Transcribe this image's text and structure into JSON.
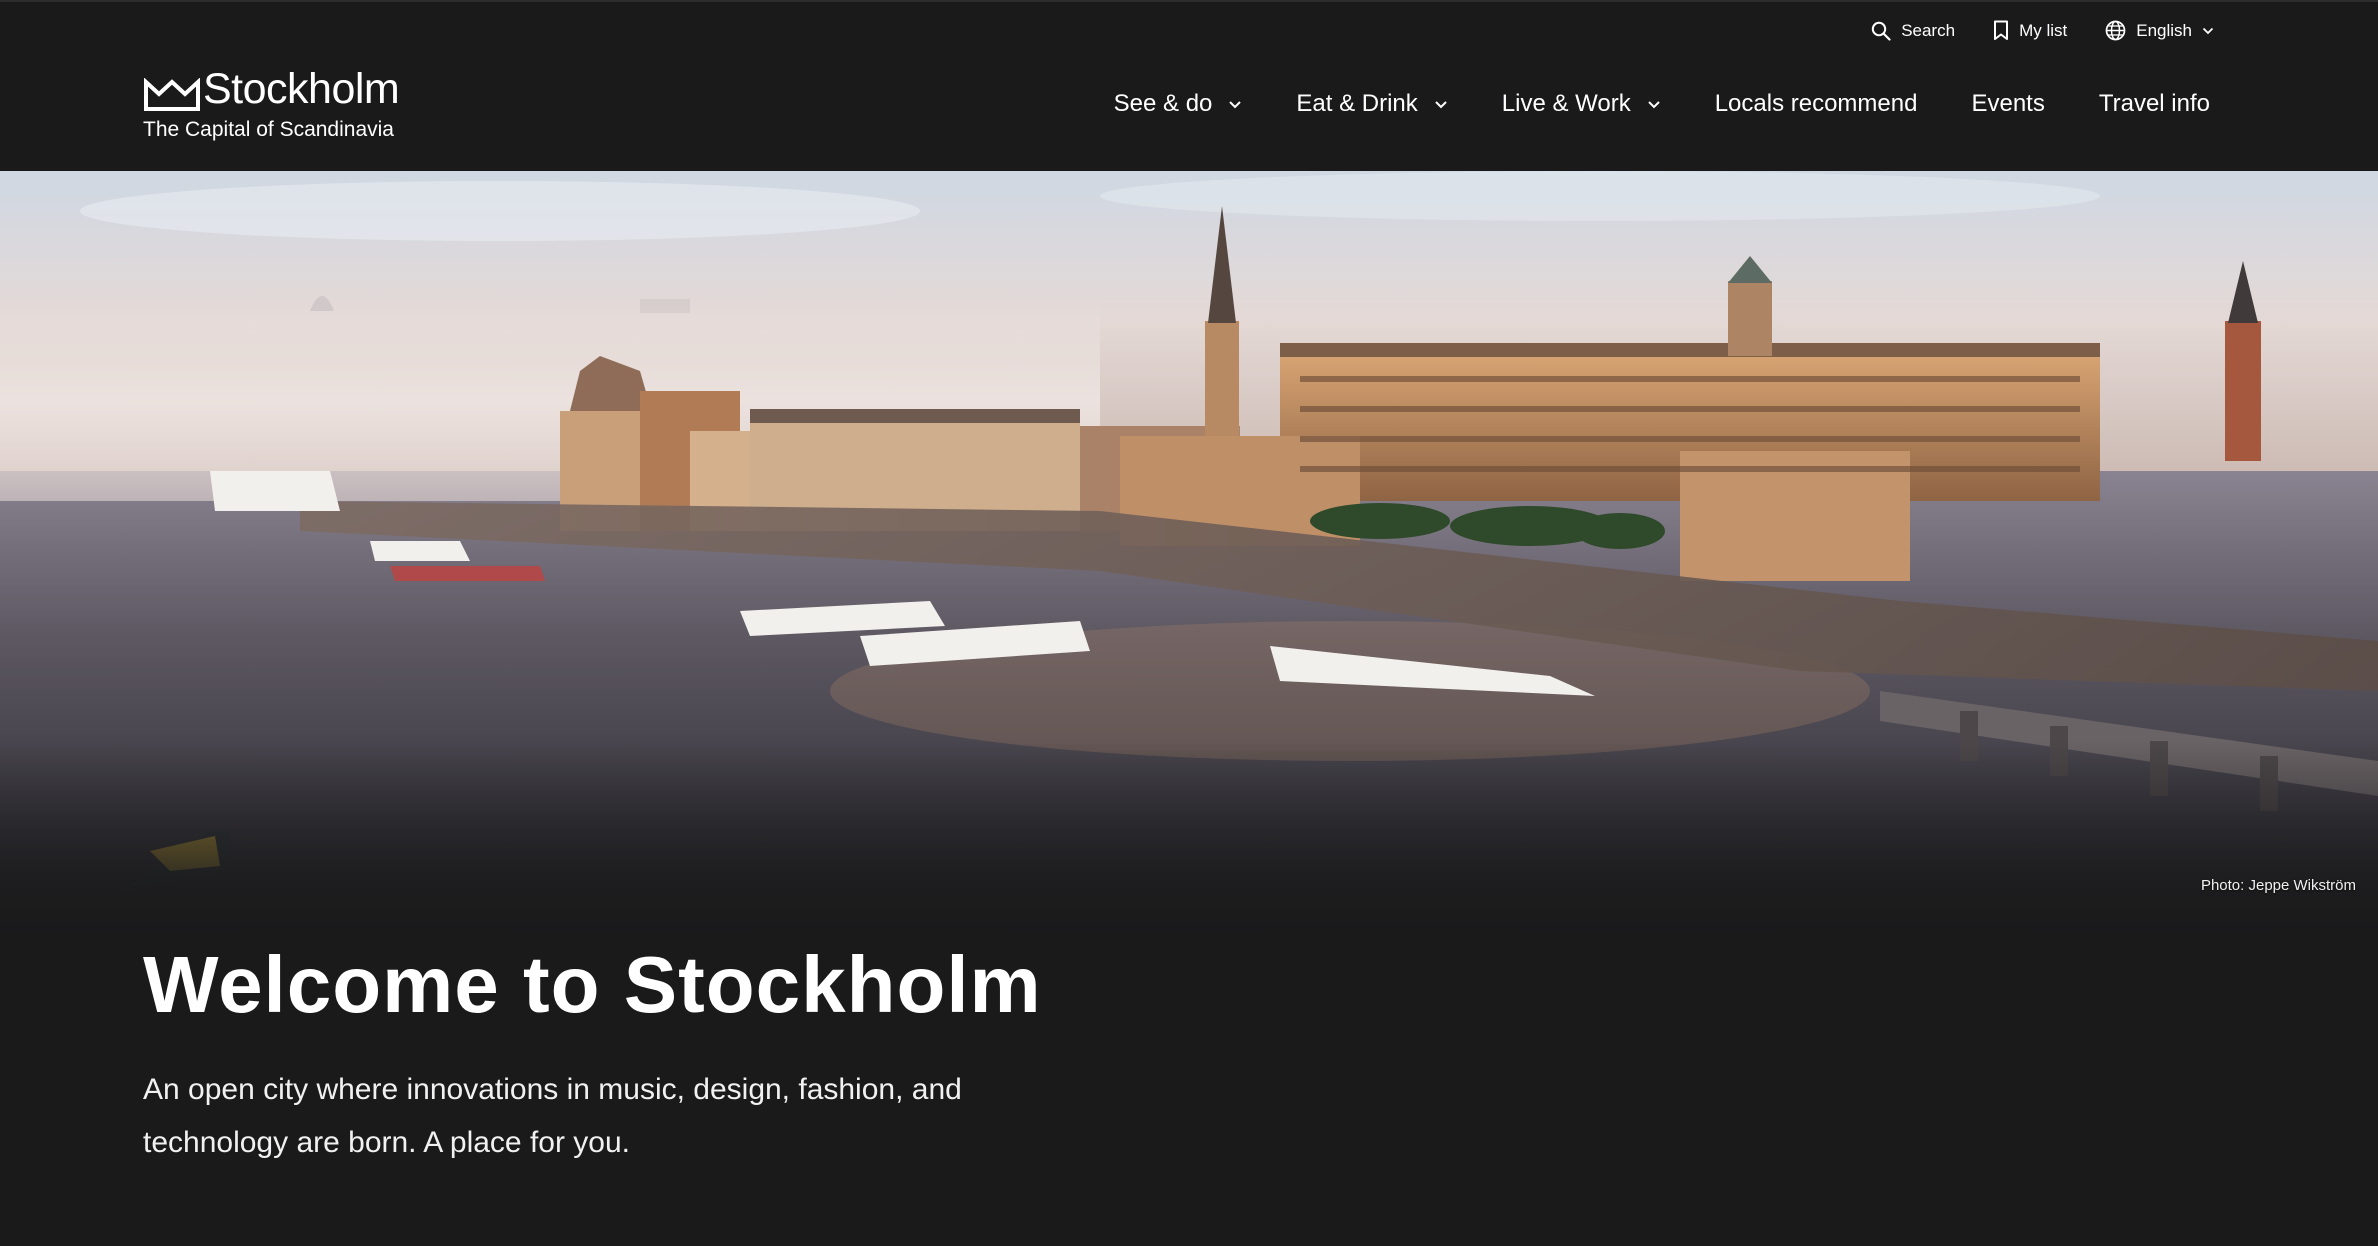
{
  "utility_nav": {
    "search_label": "Search",
    "mylist_label": "My list",
    "language_label": "English"
  },
  "logo": {
    "title": "Stockholm",
    "subtitle": "The Capital of Scandinavia"
  },
  "main_nav": {
    "see_do": "See & do",
    "eat_drink": "Eat & Drink",
    "live_work": "Live & Work",
    "locals": "Locals recommend",
    "events": "Events",
    "travel": "Travel info"
  },
  "hero": {
    "photo_credit": "Photo: Jeppe Wikström"
  },
  "intro": {
    "heading": "Welcome to Stockholm",
    "text": "An open city where innovations in music, design, fashion, and technology are born. A place for you."
  },
  "colors": {
    "background": "#1a1a1b",
    "text": "#ffffff"
  }
}
